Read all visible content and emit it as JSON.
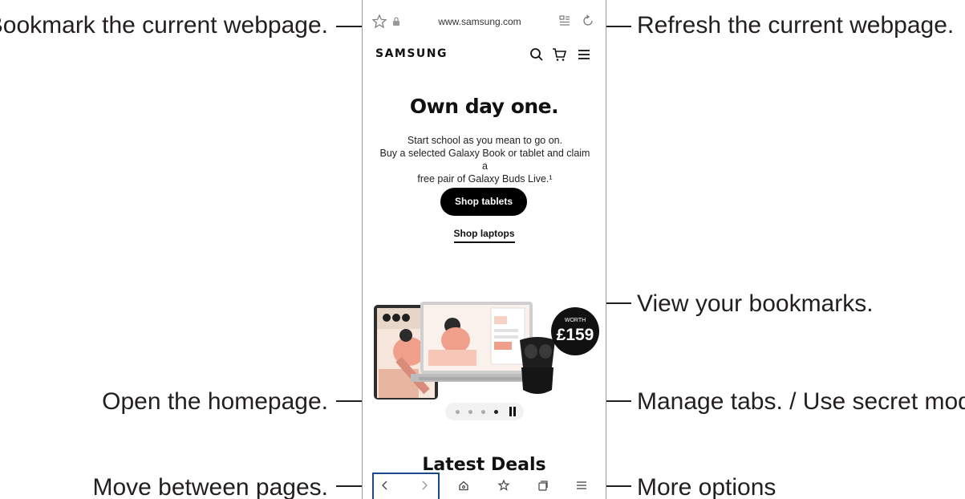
{
  "callouts": {
    "bookmark_current": "Bookmark the current webpage.",
    "refresh": "Refresh the current webpage.",
    "view_bookmarks": "View your bookmarks.",
    "open_home": "Open the homepage.",
    "manage_tabs": "Manage tabs. / Use secret mode.",
    "move_pages": "Move between pages.",
    "more_options": "More options"
  },
  "browser": {
    "url": "www.samsung.com"
  },
  "site": {
    "brand": "SAMSUNG",
    "headline": "Own day one.",
    "subtext_1": "Start school as you mean to go on.",
    "subtext_2": "Buy a selected Galaxy Book or tablet and claim a",
    "subtext_3": "free pair of Galaxy Buds Live.¹",
    "primary_button": "Shop tablets",
    "secondary_link": "Shop laptops",
    "badge_top": "WORTH",
    "badge_price": "£159",
    "section_heading": "Latest Deals"
  },
  "carousel": {
    "slide_count": 4,
    "active_slide": 4
  },
  "colors": {
    "text": "#231f20",
    "button": "#000000",
    "nav_highlight": "#1a4a8c"
  }
}
